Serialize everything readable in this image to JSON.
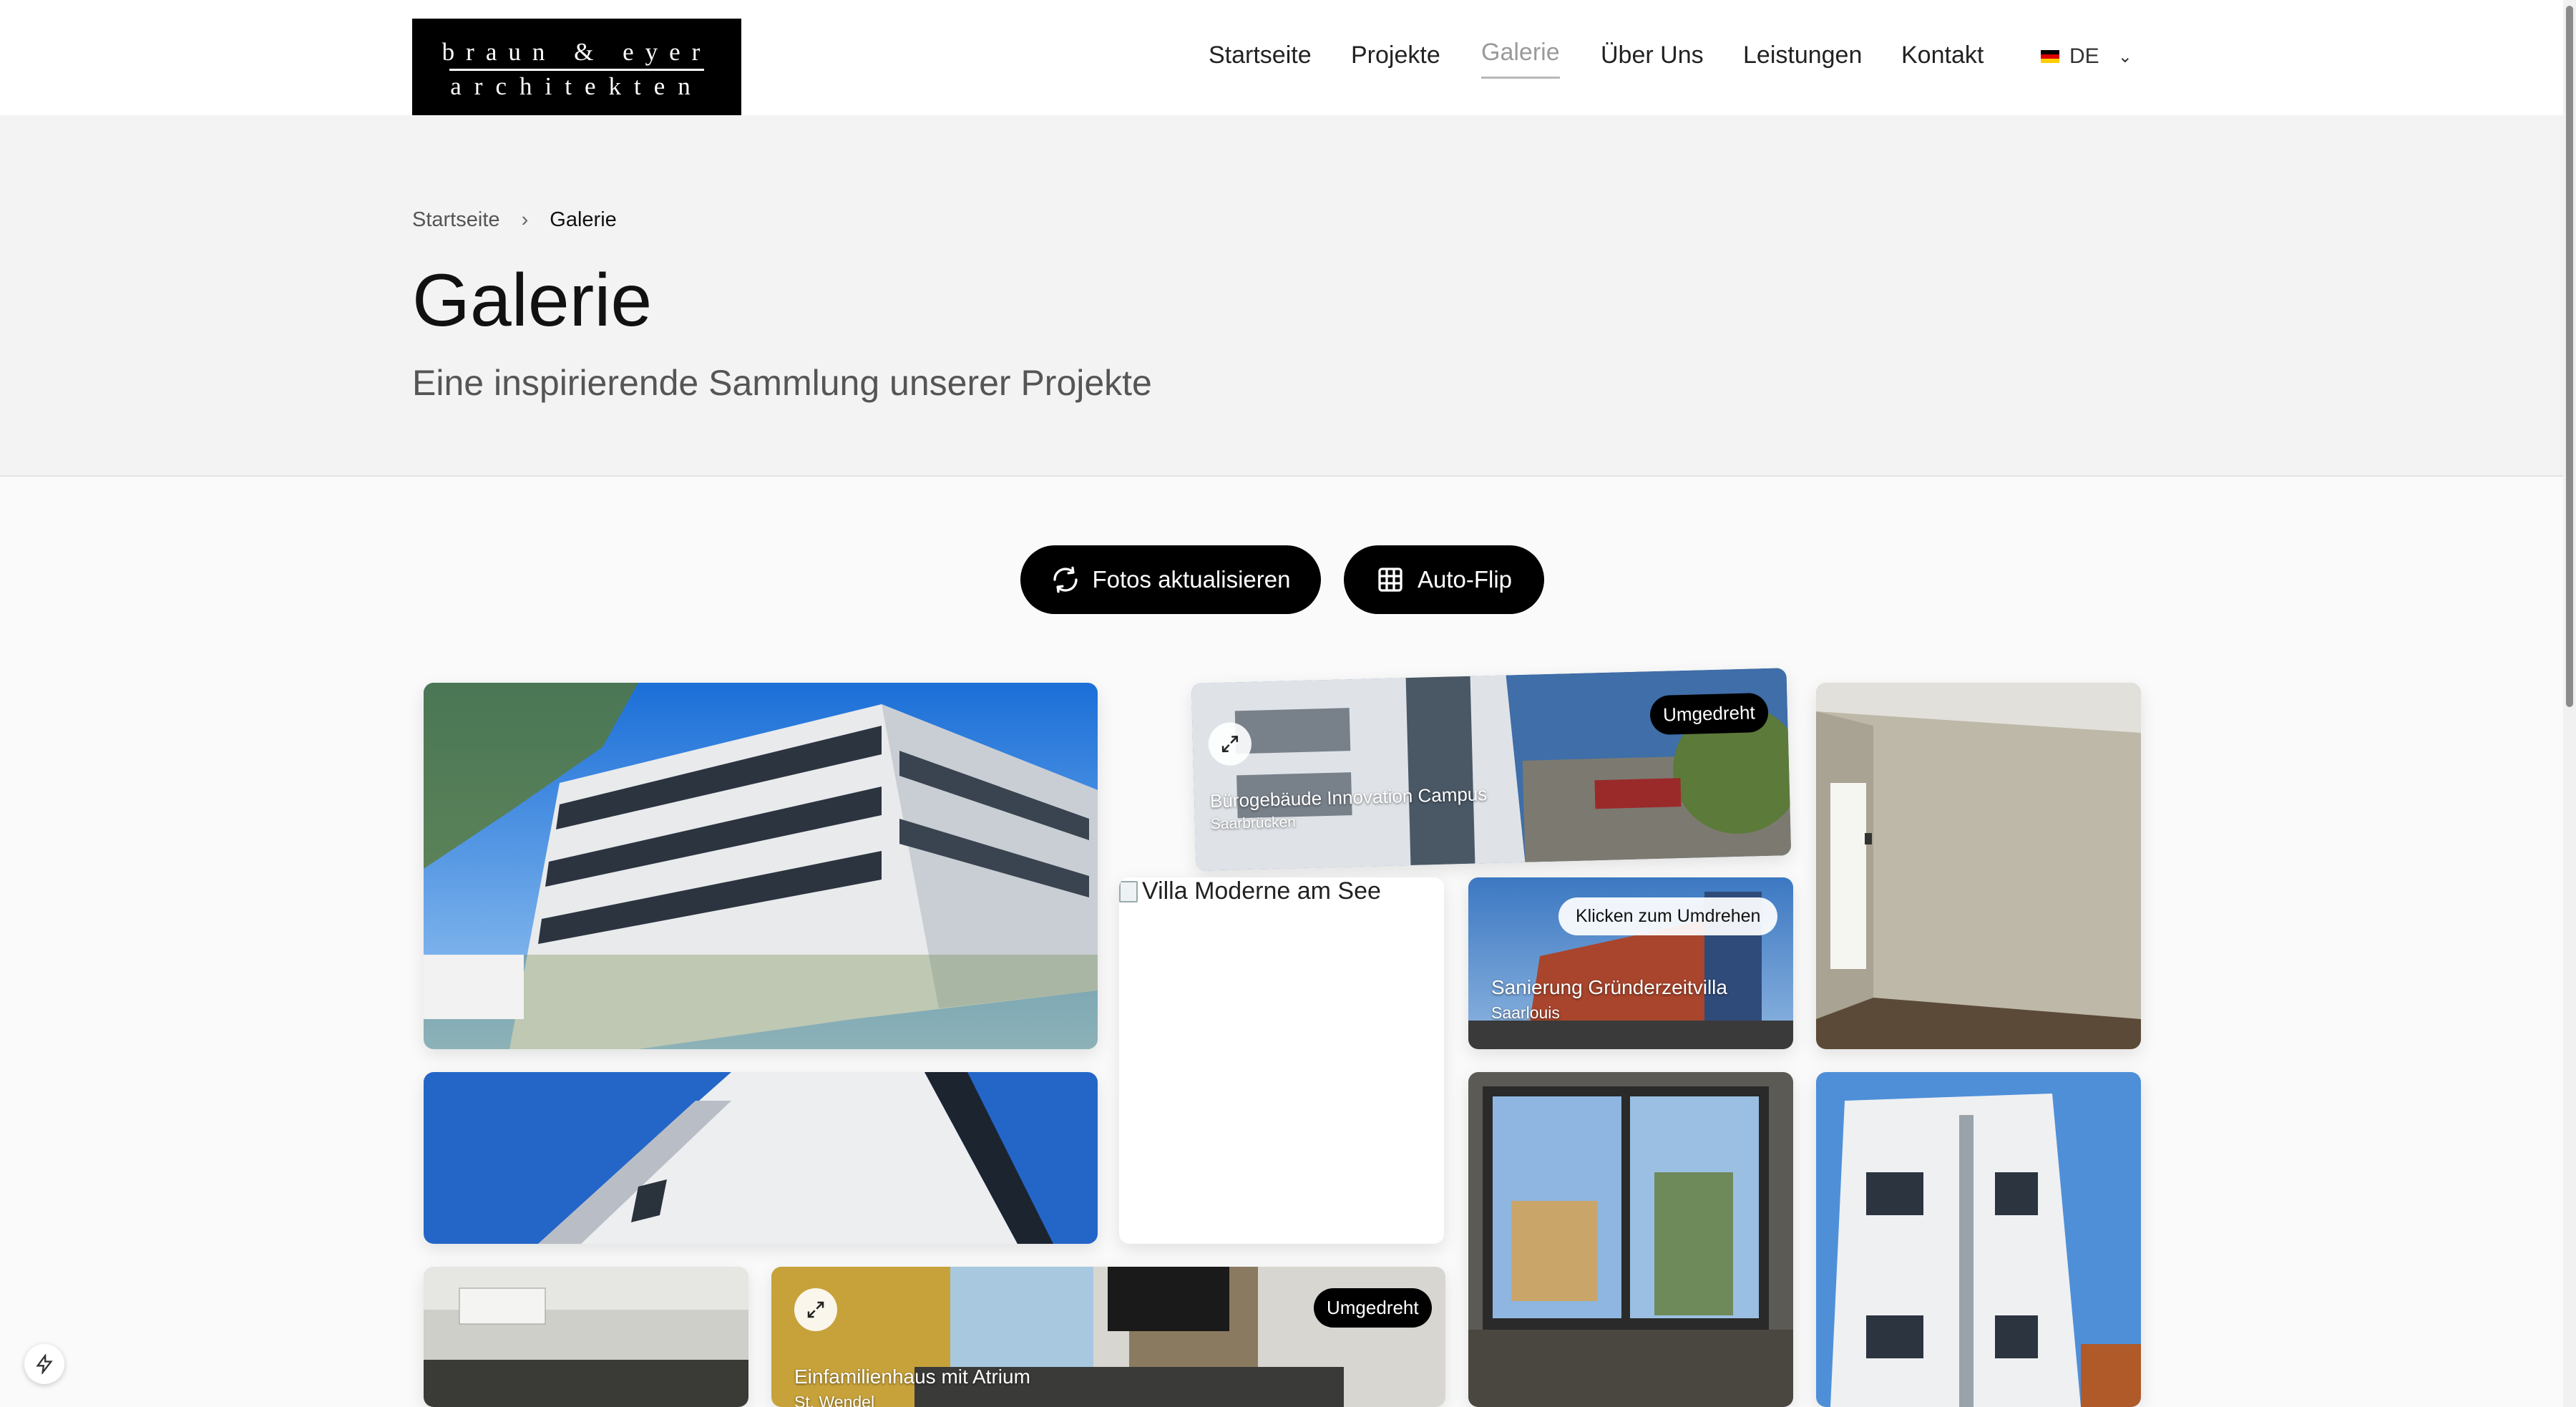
{
  "header": {
    "logo": {
      "line1": "braun & eyer",
      "line2": "architekten"
    },
    "nav": [
      "Startseite",
      "Projekte",
      "Galerie",
      "Über Uns",
      "Leistungen",
      "Kontakt"
    ],
    "active_nav": "Galerie",
    "language": "DE"
  },
  "hero": {
    "breadcrumb": {
      "home": "Startseite",
      "current": "Galerie"
    },
    "title": "Galerie",
    "subtitle": "Eine inspirierende Sammlung unserer Projekte"
  },
  "actions": {
    "refresh_label": "Fotos aktualisieren",
    "autoflip_label": "Auto-Flip"
  },
  "gallery": {
    "card_campus": {
      "title": "Bürogebäude Innovation Campus",
      "location": "Saarbrücken",
      "badge": "Umgedreht"
    },
    "card_villa": {
      "alt": "Villa Moderne am See"
    },
    "card_sanierung": {
      "title": "Sanierung Gründerzeitvilla",
      "location": "Saarlouis",
      "hint": "Klicken zum Umdrehen"
    },
    "card_einfamilienhaus": {
      "title": "Einfamilienhaus mit Atrium",
      "location": "St. Wendel",
      "badge": "Umgedreht"
    }
  },
  "colors": {
    "accent": "#000000",
    "active_nav": "#9a9a9a",
    "hero_bg": "#f3f3f3"
  }
}
